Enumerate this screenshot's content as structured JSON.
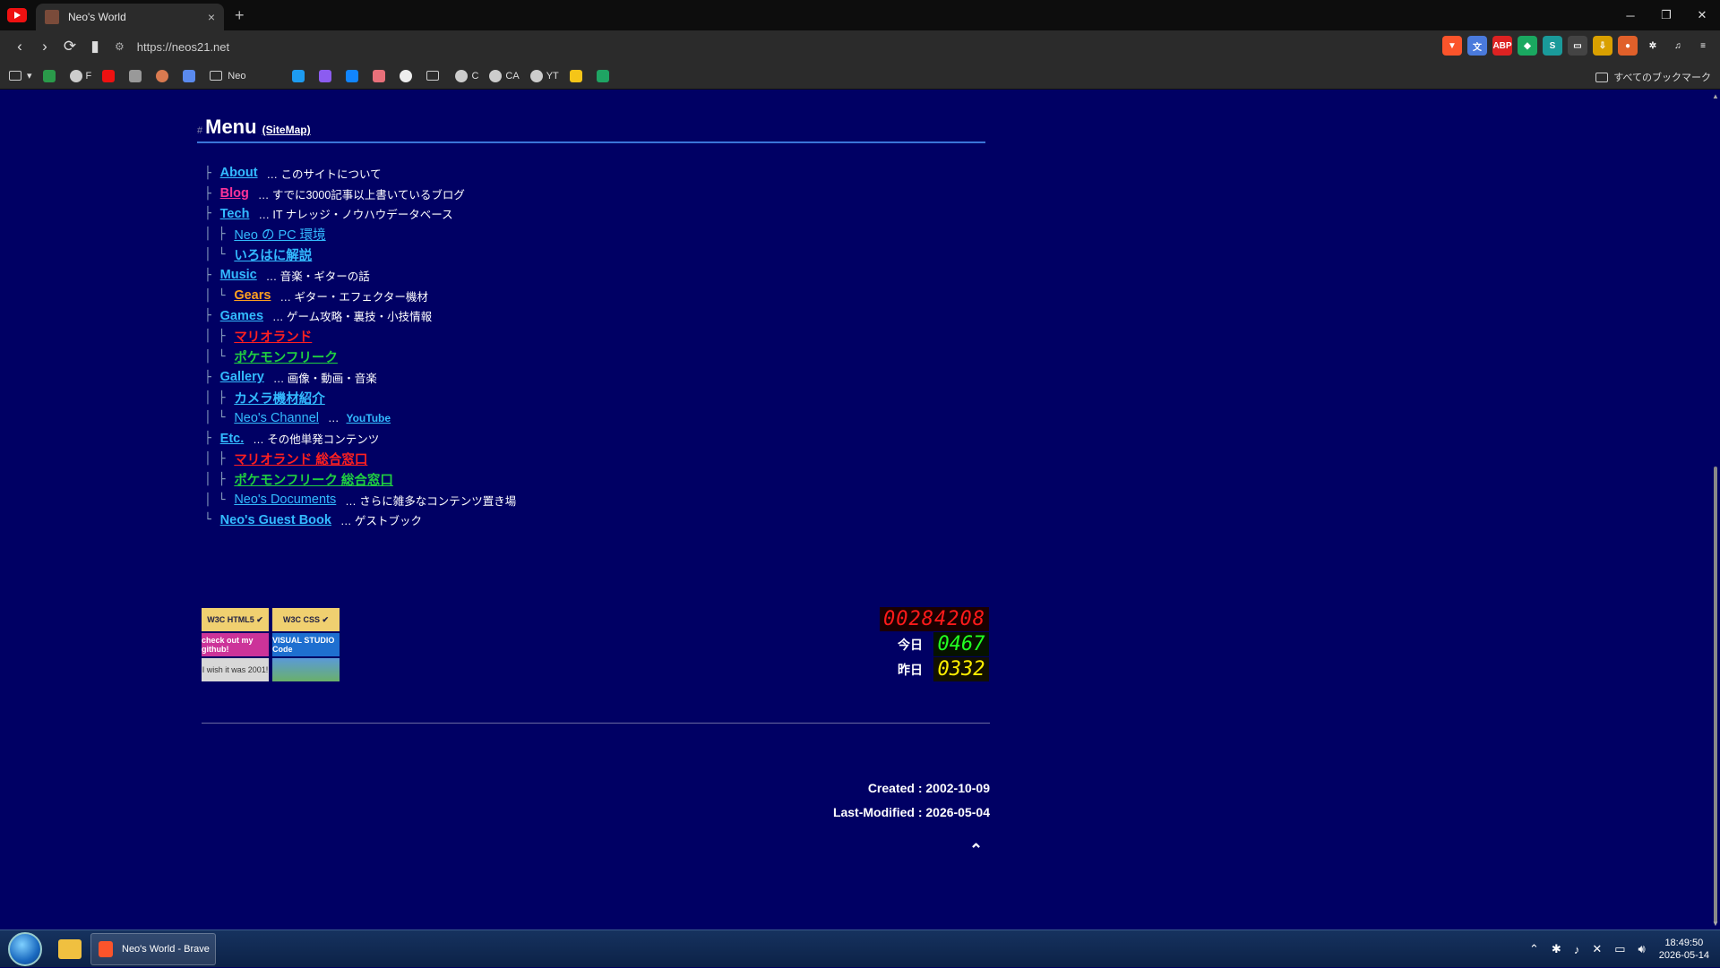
{
  "browser": {
    "tab_title": "Neo's World",
    "tab_close": "×",
    "new_tab": "+",
    "url": "https://neos21.net",
    "window_controls": [
      "─",
      "❐",
      "✕"
    ],
    "bookmarks": [
      {
        "label": "",
        "icon": "apps-icon"
      },
      {
        "label": "F",
        "icon": "globe-icon"
      },
      {
        "label": "",
        "icon": "youtube-icon"
      },
      {
        "label": "",
        "icon": "instagram-icon"
      },
      {
        "label": "",
        "icon": "claude-icon"
      },
      {
        "label": "",
        "icon": "gemini-icon"
      },
      {
        "label": "Neo",
        "icon": "folder-icon"
      },
      {
        "label": "",
        "icon": "twitter-icon"
      },
      {
        "label": "",
        "icon": "mastodon-icon"
      },
      {
        "label": "",
        "icon": "bluesky-icon"
      },
      {
        "label": "",
        "icon": "misskey-icon"
      },
      {
        "label": "",
        "icon": "threads-icon"
      },
      {
        "label": "",
        "icon": "folder-icon"
      },
      {
        "label": "C",
        "icon": "globe-icon"
      },
      {
        "label": "CA",
        "icon": "globe-icon"
      },
      {
        "label": "YT",
        "icon": "globe-icon"
      },
      {
        "label": "",
        "icon": "keep-icon"
      },
      {
        "label": "",
        "icon": "sheets-icon"
      }
    ],
    "all_bookmarks": "すべてのブックマーク"
  },
  "page": {
    "hash": "#",
    "menu_title": "Menu",
    "sitemap_label": "(SiteMap)",
    "menu": [
      {
        "branch": "├ ",
        "label": "About",
        "color": "blue",
        "desc": "… このサイトについて"
      },
      {
        "branch": "├ ",
        "label": "Blog",
        "color": "pink",
        "desc": "… すでに3000記事以上書いているブログ"
      },
      {
        "branch": "├ ",
        "label": "Tech",
        "color": "blue",
        "desc": "… IT ナレッジ・ノウハウデータベース"
      },
      {
        "branch": "│ ├ ",
        "label": "Neo の PC 環境",
        "color": "blue",
        "desc": "",
        "normal": true
      },
      {
        "branch": "│ └ ",
        "label": "いろはに解説",
        "color": "blue",
        "desc": ""
      },
      {
        "branch": "├ ",
        "label": "Music",
        "color": "blue",
        "desc": "… 音楽・ギターの話"
      },
      {
        "branch": "│ └ ",
        "label": "Gears",
        "color": "orange",
        "desc": "… ギター・エフェクター機材"
      },
      {
        "branch": "├ ",
        "label": "Games",
        "color": "blue",
        "desc": "… ゲーム攻略・裏技・小技情報"
      },
      {
        "branch": "│ ├ ",
        "label": "マリオランド",
        "color": "red",
        "desc": ""
      },
      {
        "branch": "│ └ ",
        "label": "ポケモンフリーク",
        "color": "green",
        "desc": ""
      },
      {
        "branch": "├ ",
        "label": "Gallery",
        "color": "blue",
        "desc": "… 画像・動画・音楽"
      },
      {
        "branch": "│ ├ ",
        "label": "カメラ機材紹介",
        "color": "blue",
        "desc": ""
      },
      {
        "branch": "│ └ ",
        "label": "Neo's Channel",
        "color": "blue",
        "desc": "…",
        "extra": "YouTube",
        "normal": true
      },
      {
        "branch": "├ ",
        "label": "Etc.",
        "color": "blue",
        "desc": "… その他単発コンテンツ"
      },
      {
        "branch": "│ ├ ",
        "label": "マリオランド 総合窓口",
        "color": "red",
        "desc": ""
      },
      {
        "branch": "│ ├ ",
        "label": "ポケモンフリーク 総合窓口",
        "color": "green",
        "desc": ""
      },
      {
        "branch": "│ └ ",
        "label": "Neo's Documents",
        "color": "blue",
        "desc": "… さらに雑多なコンテンツ置き場",
        "normal": true
      },
      {
        "branch": "└ ",
        "label": "Neo's Guest Book",
        "color": "blue",
        "desc": "… ゲストブック"
      }
    ],
    "badges": [
      {
        "text": "W3C HTML5 ✔",
        "bg": "#f0d070",
        "fg": "#224"
      },
      {
        "text": "W3C CSS ✔",
        "bg": "#f0d070",
        "fg": "#224"
      },
      {
        "text": "check out my github!",
        "bg": "#cc3399",
        "fg": "#fff"
      },
      {
        "text": "VISUAL STUDIO Code",
        "bg": "#1e6fd0",
        "fg": "#fff"
      },
      {
        "text": "I wish it was 2001!",
        "bg": "#d8d8d8",
        "fg": "#333"
      },
      {
        "text": "",
        "bg": "#5a9ad8",
        "fg": "#fff"
      }
    ],
    "counter": {
      "total": "00284208",
      "today_label": "今日",
      "today": "0467",
      "yesterday_label": "昨日",
      "yesterday": "0332"
    },
    "created": "Created : 2002-10-09",
    "modified": "Last-Modified : 2026-05-04",
    "to_top": "⌃"
  },
  "taskbar": {
    "app_label": "Neo's World - Brave",
    "time": "18:49:50",
    "date": "2026-05-14"
  },
  "colors": {
    "background": "#000064",
    "link_blue": "#33bbff",
    "link_pink": "#ff3399",
    "link_orange": "#ffa020",
    "link_red": "#ff2020",
    "link_green": "#20d040"
  }
}
